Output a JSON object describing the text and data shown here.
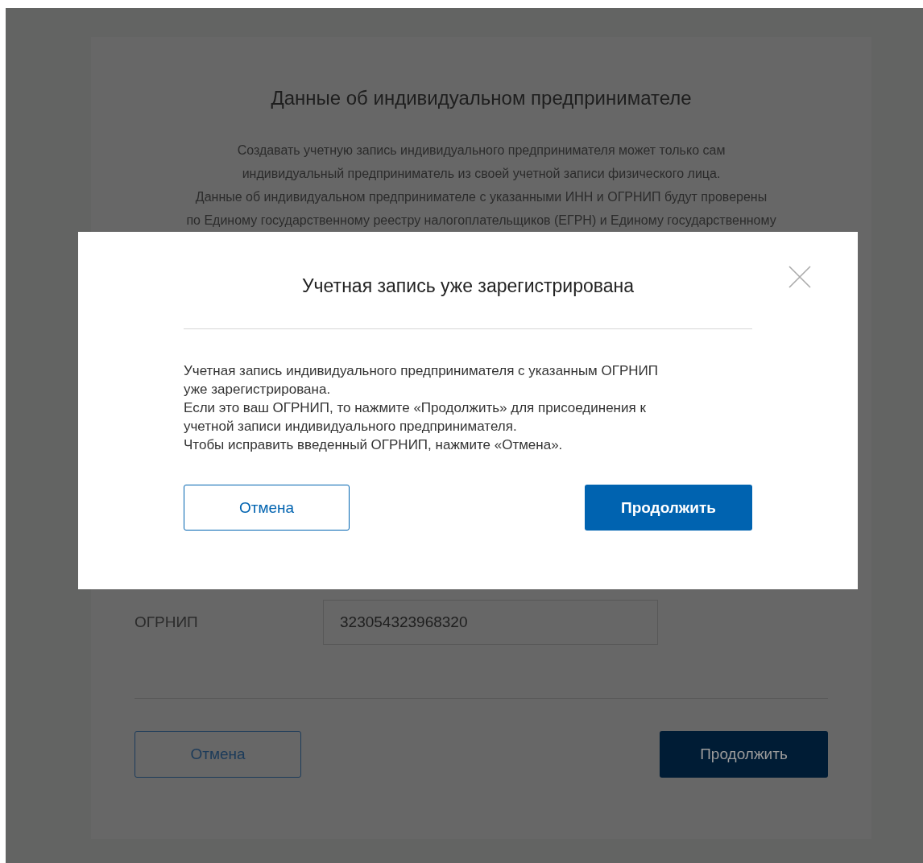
{
  "page": {
    "title": "Данные об индивидуальном предпринимателе",
    "intro": [
      "Создавать учетную запись индивидуального предпринимателя может только сам",
      "индивидуальный предприниматель из своей учетной записи физического лица.",
      "Данные об индивидуальном предпринимателе с указанными ИНН и ОГРНИП будут проверены",
      "по Единому государственному реестру налогоплательщиков (ЕГРН) и Единому государственному"
    ],
    "field": {
      "label": "ОГРНИП",
      "value": "323054323968320"
    },
    "buttons": [
      {
        "kind": "secondary",
        "label": "Отмена"
      },
      {
        "kind": "primary",
        "label": "Продолжить"
      }
    ]
  },
  "dialog": {
    "title": "Учетная запись уже зарегистрирована",
    "message": [
      "Учетная запись индивидуального предпринимателя с указанным ОГРНИП",
      "уже зарегистрирована.",
      "Если это ваш ОГРНИП, то нажмите «Продолжить» для присоединения к",
      "учетной записи индивидуального предпринимателя.",
      "Чтобы исправить введенный ОГРНИП, нажмите «Отмена»."
    ],
    "buttons": [
      {
        "kind": "secondary",
        "label": "Отмена"
      },
      {
        "kind": "primary",
        "label": "Продолжить"
      }
    ]
  }
}
